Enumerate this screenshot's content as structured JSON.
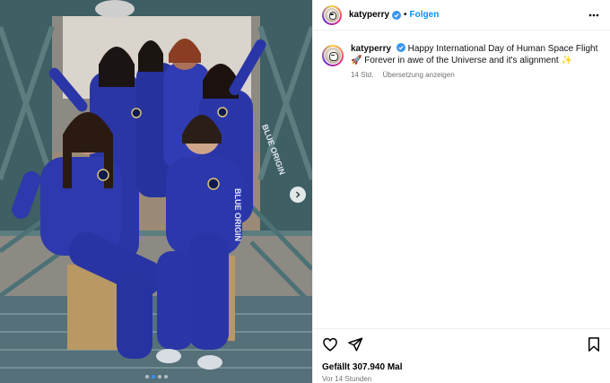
{
  "post": {
    "username": "katyperry",
    "follow_label": "Folgen",
    "separator": "•",
    "caption_user": "katyperry",
    "caption_text": "Happy International Day of Human Space Flight 🚀 Forever in awe of the Universe and it's alignment ✨",
    "caption_age": "14 Std.",
    "translate_label": "Übersetzung anzeigen",
    "likes": "Gefällt 307.940 Mal",
    "posted_ago": "Vor 14 Stunden",
    "photo_patch_text": "BLUE ORIGIN",
    "carousel": {
      "slide_count": 4,
      "active_slide": 2
    }
  },
  "icons": {
    "verified": "verified-badge-icon",
    "more": "more-options-icon",
    "like": "heart-icon",
    "share": "paper-plane-icon",
    "save": "bookmark-icon",
    "next": "chevron-right-icon"
  },
  "colors": {
    "accent_blue": "#0095f6",
    "verified_blue": "#3897f0",
    "suit_blue": "#2a36a8",
    "meta_gray": "#737373"
  }
}
